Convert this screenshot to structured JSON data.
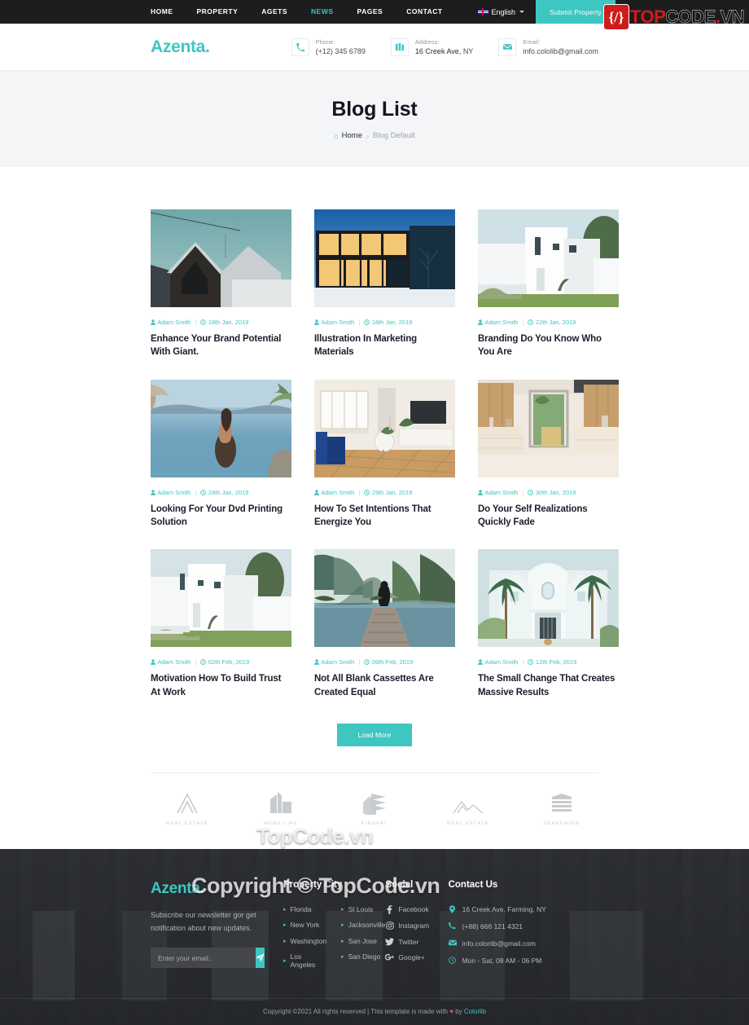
{
  "topbar": {
    "nav": [
      {
        "label": "HOME",
        "active": false
      },
      {
        "label": "PROPERTY",
        "active": false
      },
      {
        "label": "AGETS",
        "active": false
      },
      {
        "label": "NEWS",
        "active": true
      },
      {
        "label": "PAGES",
        "active": false
      },
      {
        "label": "CONTACT",
        "active": false
      }
    ],
    "language": "English",
    "submit_label": "Submit Property",
    "accent": "#3ec6c1"
  },
  "watermark_logo": {
    "badge": "{/}",
    "top": "TOP",
    "code": "CODE",
    "dot": ".",
    "vn": "VN",
    "red": "#cf1b1b"
  },
  "header": {
    "brand": "Azenta",
    "brand_dot": ".",
    "contacts": [
      {
        "icon": "phone-icon",
        "label": "Phone:",
        "value": "(+12) 345 6789",
        "value_bold": "(+12) 345 6789",
        "value_rest": ""
      },
      {
        "icon": "building-icon",
        "label": "Address:",
        "value_bold": "16 Creek Ave,",
        "value_rest": "NY"
      },
      {
        "icon": "envelope-icon",
        "label": "Email:",
        "value_bold": "info.cololib@gmail.com",
        "value_rest": ""
      }
    ]
  },
  "hero": {
    "title": "Blog List",
    "home": "Home",
    "separator": "›",
    "current": "Blog Default"
  },
  "blog": {
    "author": "Adam Smith",
    "posts": [
      {
        "author": "Adam Smith",
        "date": "18th Jan, 2019",
        "title": "Enhance Your Brand Potential With Giant.",
        "image": "dark-gable-house"
      },
      {
        "author": "Adam Smith",
        "date": "18th Jan, 2019",
        "title": "Illustration In Marketing Materials",
        "image": "lit-glass-house-night"
      },
      {
        "author": "Adam Smith",
        "date": "22th Jan, 2019",
        "title": "Branding Do You Know Who You Are",
        "image": "white-modern-villa"
      },
      {
        "author": "Adam Smith",
        "date": "24th Jan, 2019",
        "title": "Looking For Your Dvd Printing Solution",
        "image": "infinity-pool-ocean"
      },
      {
        "author": "Adam Smith",
        "date": "29th Jan, 2019",
        "title": "How To Set Intentions That Energize You",
        "image": "living-room-blue-sofa"
      },
      {
        "author": "Adam Smith",
        "date": "30th Jan, 2019",
        "title": "Do Your Self Realizations Quickly Fade",
        "image": "wood-kitchen-interior"
      },
      {
        "author": "Adam Smith",
        "date": "02th Feb, 2019",
        "title": "Motivation How To Build Trust At Work",
        "image": "white-cubic-house"
      },
      {
        "author": "Adam Smith",
        "date": "09th Feb, 2019",
        "title": "Not All Blank Cassettes Are Created Equal",
        "image": "lake-dock-mountains"
      },
      {
        "author": "Adam Smith",
        "date": "12th Feb, 2019",
        "title": "The Small Change That Creates Massive Results",
        "image": "palm-mansion"
      }
    ],
    "load_more": "Load More"
  },
  "partners": [
    {
      "name": "REAL ESTATE",
      "icon": "arch-logo"
    },
    {
      "name": "HOME LIFE",
      "icon": "buildings-logo"
    },
    {
      "name": "KINGFAT",
      "icon": "roof-logo"
    },
    {
      "name": "REAL ESTATE",
      "icon": "mountain-logo"
    },
    {
      "name": "SEARCHING",
      "icon": "stack-logo"
    }
  ],
  "footer": {
    "brand": "Azenta",
    "brand_dot": ".",
    "description": "Subscribe our newsletter gor get notification about new updates.",
    "newsletter_placeholder": "Enter your email..",
    "city": {
      "title": "Property City",
      "col1": [
        "Florida",
        "New York",
        "Washington",
        "Los Angeles"
      ],
      "col2": [
        "St Louis",
        "Jacksonville",
        "San Jose",
        "San Diego"
      ]
    },
    "social": {
      "title": "Social",
      "items": [
        {
          "label": "Facebook",
          "icon": "facebook-icon",
          "glyph": "f"
        },
        {
          "label": "Instagram",
          "icon": "instagram-icon",
          "glyph": "◙"
        },
        {
          "label": "Twitter",
          "icon": "twitter-icon",
          "glyph": "🐦"
        },
        {
          "label": "Google+",
          "icon": "googleplus-icon",
          "glyph": "g+"
        }
      ]
    },
    "contact": {
      "title": "Contact Us",
      "items": [
        {
          "icon": "map-pin-icon",
          "text": "16 Creek Ave, Farming, NY"
        },
        {
          "icon": "phone-icon",
          "text": "(+88) 666 121 4321"
        },
        {
          "icon": "envelope-icon",
          "text": "info.colorlib@gmail.com"
        },
        {
          "icon": "clock-icon",
          "text": "Mon - Sat, 08 AM - 06 PM"
        }
      ]
    },
    "copyright_pre": "Copyright ©2021 All rights reserved | This template is made with ",
    "copyright_heart": "♥",
    "copyright_mid": " by ",
    "copyright_link": "Colorlib"
  },
  "overlay_watermarks": {
    "line1": "TopCode.vn",
    "line2": "Copyright © TopCode.vn"
  }
}
